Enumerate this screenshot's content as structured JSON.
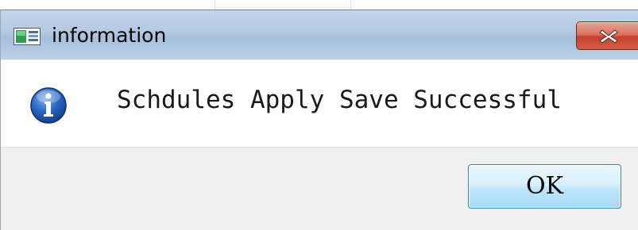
{
  "dialog": {
    "title": "information",
    "message": "Schdules Apply Save Successful",
    "ok_label": "OK"
  },
  "icons": {
    "app": "application-window-icon",
    "close": "close-icon",
    "info": "information-icon"
  },
  "colors": {
    "titlebar": "#b3c9e2",
    "close_button": "#c7412c",
    "info_icon": "#1f5fb8",
    "footer": "#f0f0f0",
    "ok_border": "#3c7fb1"
  }
}
